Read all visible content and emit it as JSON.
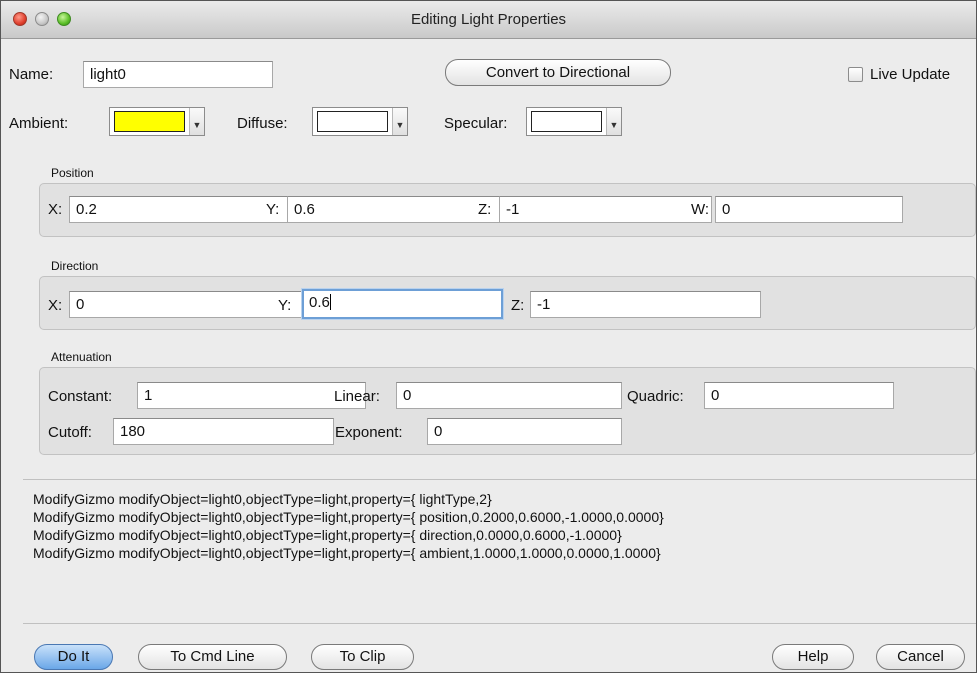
{
  "window": {
    "title": "Editing Light Properties"
  },
  "top": {
    "name_label": "Name:",
    "name_value": "light0",
    "convert_button": "Convert to Directional",
    "live_update_label": "Live Update",
    "live_update_checked": false
  },
  "colors": {
    "ambient_label": "Ambient:",
    "ambient_color": "#ffff00",
    "diffuse_label": "Diffuse:",
    "diffuse_color": "#ffffff",
    "specular_label": "Specular:",
    "specular_color": "#ffffff"
  },
  "position": {
    "title": "Position",
    "x_label": "X:",
    "x": "0.2",
    "y_label": "Y:",
    "y": "0.6",
    "z_label": "Z:",
    "z": "-1",
    "w_label": "W:",
    "w": "0"
  },
  "direction": {
    "title": "Direction",
    "x_label": "X:",
    "x": "0",
    "y_label": "Y:",
    "y": "0.6",
    "z_label": "Z:",
    "z": "-1"
  },
  "attenuation": {
    "title": "Attenuation",
    "constant_label": "Constant:",
    "constant": "1",
    "linear_label": "Linear:",
    "linear": "0",
    "quadric_label": "Quadric:",
    "quadric": "0",
    "cutoff_label": "Cutoff:",
    "cutoff": "180",
    "exponent_label": "Exponent:",
    "exponent": "0"
  },
  "log": [
    "ModifyGizmo modifyObject=light0,objectType=light,property={ lightType,2}",
    "ModifyGizmo modifyObject=light0,objectType=light,property={ position,0.2000,0.6000,-1.0000,0.0000}",
    "ModifyGizmo modifyObject=light0,objectType=light,property={ direction,0.0000,0.6000,-1.0000}",
    "ModifyGizmo modifyObject=light0,objectType=light,property={ ambient,1.0000,1.0000,0.0000,1.0000}"
  ],
  "buttons": {
    "do_it": "Do It",
    "to_cmd_line": "To Cmd Line",
    "to_clip": "To Clip",
    "help": "Help",
    "cancel": "Cancel"
  }
}
